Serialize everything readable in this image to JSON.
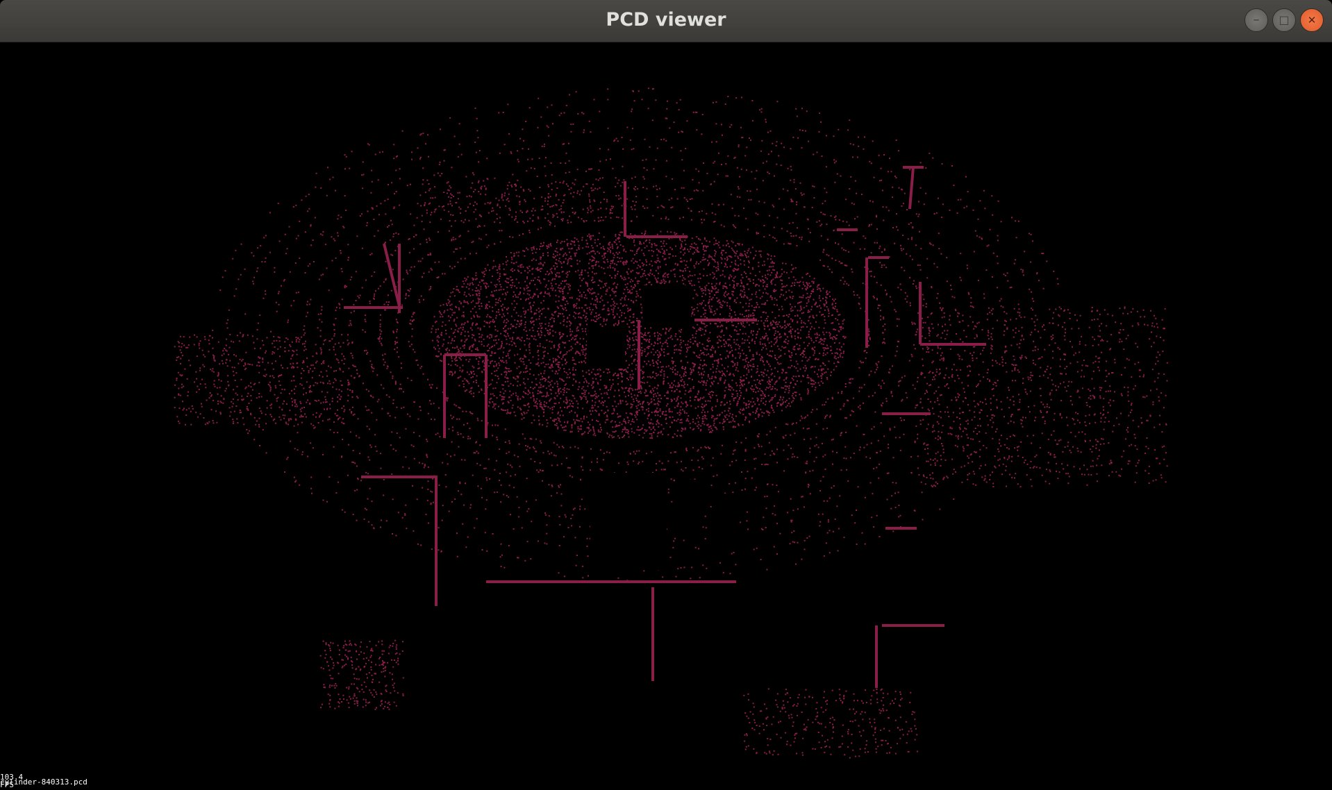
{
  "window": {
    "title": "PCD viewer",
    "controls": {
      "minimize_glyph": "–",
      "maximize_glyph": "□",
      "close_glyph": "✕"
    }
  },
  "viewer": {
    "background_color": "#000000",
    "point_color": "#8a1e48",
    "fps_label": "103.4 FPS",
    "file_label": "cylinder-840313.pcd"
  },
  "colors": {
    "titlebar": "#3f3e3b",
    "title_text": "#e0e0dc",
    "close_button": "#e95420"
  }
}
